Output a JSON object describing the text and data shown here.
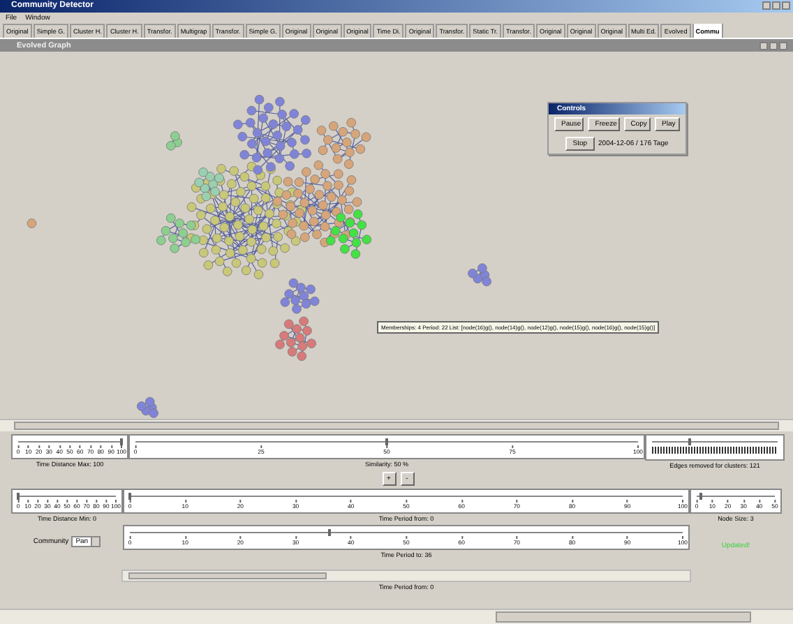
{
  "window": {
    "title": "Community Detector"
  },
  "menu": [
    "File",
    "Window"
  ],
  "tabs": [
    {
      "label": "Original",
      "selected": false
    },
    {
      "label": "Simple G.",
      "selected": false
    },
    {
      "label": "Cluster H.",
      "selected": false
    },
    {
      "label": "Cluster H.",
      "selected": false
    },
    {
      "label": "Transfor.",
      "selected": false
    },
    {
      "label": "Multigrap",
      "selected": false
    },
    {
      "label": "Transfor.",
      "selected": false
    },
    {
      "label": "Simple G.",
      "selected": false
    },
    {
      "label": "Original",
      "selected": false
    },
    {
      "label": "Original",
      "selected": false
    },
    {
      "label": "Original",
      "selected": false
    },
    {
      "label": "Time Di.",
      "selected": false
    },
    {
      "label": "Original",
      "selected": false
    },
    {
      "label": "Transfor.",
      "selected": false
    },
    {
      "label": "Static Tr.",
      "selected": false
    },
    {
      "label": "Transfor.",
      "selected": false
    },
    {
      "label": "Original",
      "selected": false
    },
    {
      "label": "Original",
      "selected": false
    },
    {
      "label": "Original",
      "selected": false
    },
    {
      "label": "Multi Ed.",
      "selected": false
    },
    {
      "label": "Evolved",
      "selected": false
    },
    {
      "label": "Commu",
      "selected": true
    }
  ],
  "graph_window": {
    "title": "Evolved Graph",
    "tooltip": "Memberships: 4 Period: 22 List: [node(16)g(), node(14)g(), node(12)g(), node(15)g(), node(16)g(), node(15)g()]"
  },
  "controls_window": {
    "title": "Controls",
    "buttons": [
      "Pause",
      "Freeze",
      "Copy",
      "Play"
    ],
    "stop_button": "Stop",
    "date": "2004-12-06 / 176 Tage"
  },
  "sliders": [
    {
      "caption": "Time Distance Max: 100",
      "level": 1.0,
      "ticks": [
        "0",
        "10",
        "20",
        "30",
        "40",
        "50",
        "60",
        "70",
        "80",
        "90",
        "100"
      ]
    },
    {
      "caption": "Similarity: 50 %",
      "level": 0.5,
      "ticks": [
        "0",
        "25",
        "50",
        "75",
        "100"
      ]
    },
    {
      "caption": "Edges removed for clusters: 121",
      "level": 0.3
    },
    {
      "caption": "Time Distance Min: 0",
      "level": 0.0,
      "ticks": [
        "0",
        "10",
        "20",
        "30",
        "40",
        "50",
        "60",
        "70",
        "80",
        "90",
        "100"
      ]
    },
    {
      "caption": "Time Period from: 0",
      "level": 0.0,
      "ticks": [
        "0",
        "10",
        "20",
        "30",
        "40",
        "50",
        "60",
        "70",
        "80",
        "90",
        "100"
      ]
    },
    {
      "caption": "Node Size: 3",
      "level": 0.06,
      "ticks": [
        "0",
        "10",
        "20",
        "30",
        "40",
        "50"
      ]
    },
    {
      "caption": "Time Period to: 36",
      "level": 0.36,
      "ticks": [
        "0",
        "10",
        "20",
        "30",
        "40",
        "50",
        "60",
        "70",
        "80",
        "90",
        "100"
      ]
    }
  ],
  "zoom_buttons": [
    "+",
    "-"
  ],
  "community": {
    "label": "Community",
    "value": "Pan"
  },
  "period_scroll_caption": "Time Period from: 0",
  "status": "Updated!"
}
